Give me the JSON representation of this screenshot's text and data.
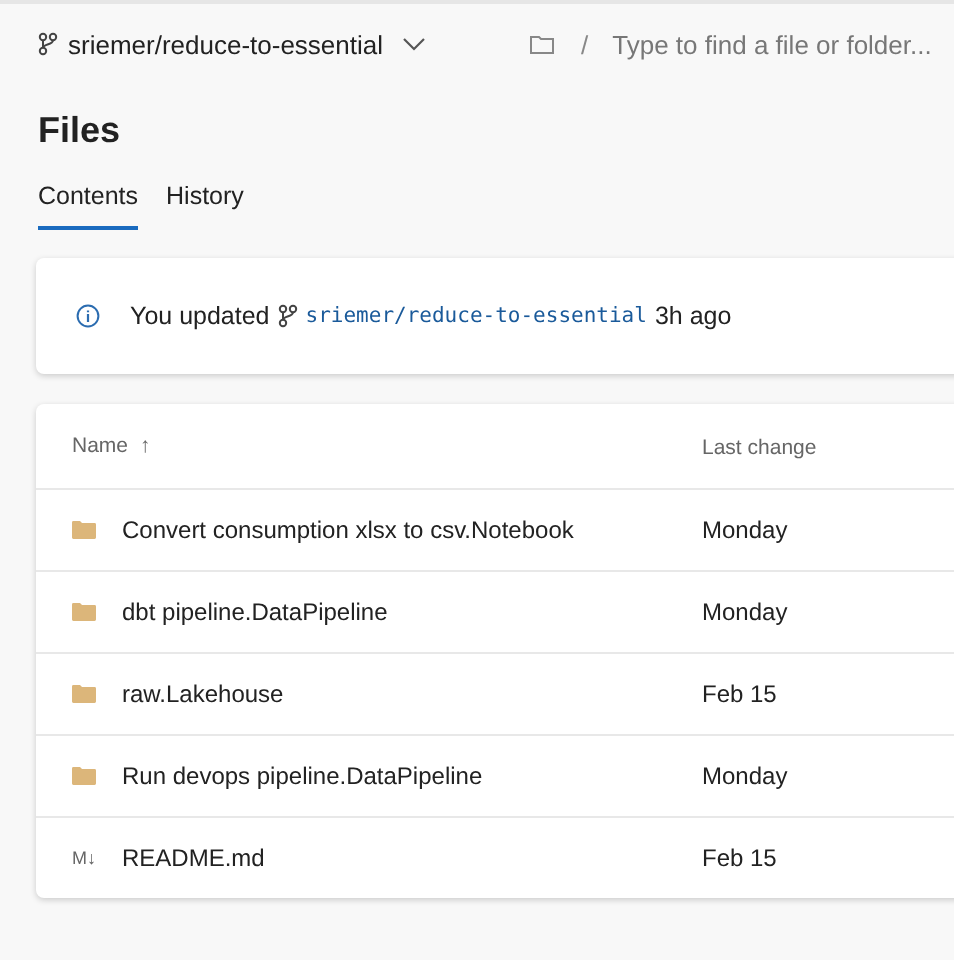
{
  "branch": {
    "name": "sriemer/reduce-to-essential"
  },
  "path_search": {
    "separator": "/",
    "placeholder": "Type to find a file or folder..."
  },
  "title": "Files",
  "tabs": [
    {
      "label": "Contents",
      "selected": true
    },
    {
      "label": "History",
      "selected": false
    }
  ],
  "notice": {
    "before": "You updated",
    "branch": "sriemer/reduce-to-essential",
    "after": "3h ago"
  },
  "table": {
    "columns": [
      {
        "label": "Name",
        "sort_icon": "↑"
      },
      {
        "label": "Last change"
      }
    ],
    "rows": [
      {
        "kind": "folder",
        "name": "Convert consumption xlsx to csv.Notebook",
        "last_change": "Monday"
      },
      {
        "kind": "folder",
        "name": "dbt pipeline.DataPipeline",
        "last_change": "Monday"
      },
      {
        "kind": "folder",
        "name": "raw.Lakehouse",
        "last_change": "Feb 15"
      },
      {
        "kind": "folder",
        "name": "Run devops pipeline.DataPipeline",
        "last_change": "Monday"
      },
      {
        "kind": "markdown",
        "icon_text": "M↓",
        "name": "README.md",
        "last_change": "Feb 15"
      }
    ]
  }
}
